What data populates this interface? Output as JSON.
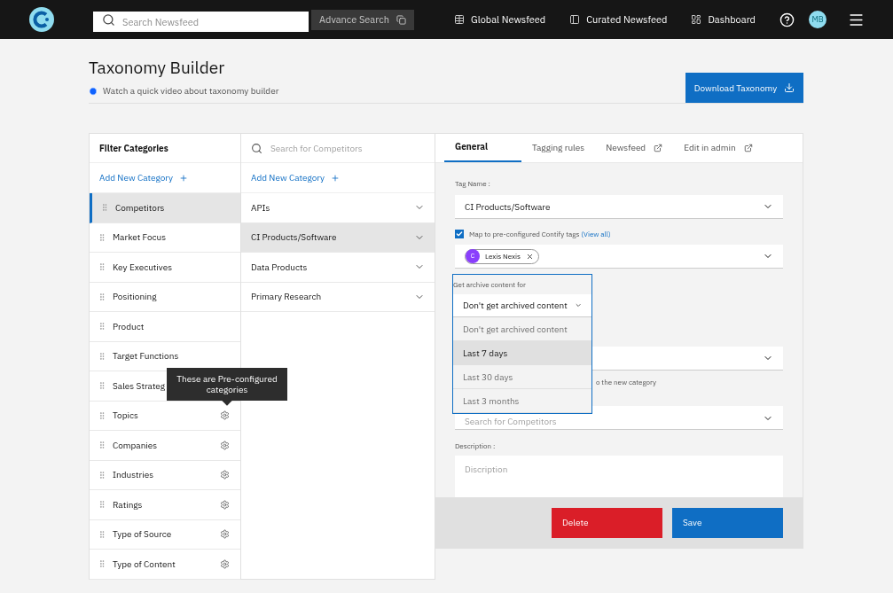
{
  "nav": {
    "search": {
      "placeholder": "Search Newsfeed"
    },
    "advance_search": "Advance Search",
    "links": [
      {
        "label": "Global Newsfeed",
        "kind": "table"
      },
      {
        "label": "Curated Newsfeed",
        "kind": "panel"
      },
      {
        "label": "Dashboard",
        "kind": "dashboard"
      }
    ],
    "avatar": "MB"
  },
  "page": {
    "title": "Taxonomy Builder",
    "video_link": "Watch a quick video about taxonomy builder",
    "download_button": "Download Taxonomy"
  },
  "categories": {
    "title": "Filter Categories",
    "add": "Add New Category",
    "items": [
      {
        "label": "Competitors",
        "selected": true,
        "preconfigured": false
      },
      {
        "label": "Market Focus",
        "selected": false,
        "preconfigured": false
      },
      {
        "label": "Key Executives",
        "selected": false,
        "preconfigured": false
      },
      {
        "label": "Positioning",
        "selected": false,
        "preconfigured": false
      },
      {
        "label": "Product",
        "selected": false,
        "preconfigured": false
      },
      {
        "label": "Target Functions",
        "selected": false,
        "preconfigured": false
      },
      {
        "label": "Sales Strateg",
        "selected": false,
        "preconfigured": false
      },
      {
        "label": "Topics",
        "selected": false,
        "preconfigured": true
      },
      {
        "label": "Companies",
        "selected": false,
        "preconfigured": true
      },
      {
        "label": "Industries",
        "selected": false,
        "preconfigured": true
      },
      {
        "label": "Ratings",
        "selected": false,
        "preconfigured": true
      },
      {
        "label": "Type of Source",
        "selected": false,
        "preconfigured": true
      },
      {
        "label": "Type of Content",
        "selected": false,
        "preconfigured": true
      }
    ],
    "tooltip": "These are Pre-configured categories"
  },
  "subcategories": {
    "search": {
      "placeholder": "Search for Competitors"
    },
    "add": "Add New Category",
    "items": [
      {
        "label": "APIs",
        "selected": false
      },
      {
        "label": "CI Products/Software",
        "selected": true
      },
      {
        "label": "Data Products",
        "selected": false
      },
      {
        "label": "Primary Research",
        "selected": false
      }
    ]
  },
  "editor": {
    "tabs": [
      {
        "label": "General",
        "selected": true,
        "external": false
      },
      {
        "label": "Tagging rules",
        "selected": false,
        "external": false
      },
      {
        "label": "Newsfeed",
        "selected": false,
        "external": true
      },
      {
        "label": "Edit in admin",
        "selected": false,
        "external": true
      }
    ],
    "tag_name": {
      "label": "Tag Name :",
      "value": "CI Products/Software"
    },
    "map_tags": {
      "checked": true,
      "label": "Map to pre-configured Contify tags",
      "link": "(View all)"
    },
    "tags": [
      {
        "initial": "C",
        "label": "Lexis Nexis"
      }
    ],
    "archive": {
      "label": "Get archive content for",
      "value": "Don't get archived content",
      "options": [
        {
          "label": "Don't get archived content",
          "highlighted": false
        },
        {
          "label": "Last 7 days",
          "highlighted": true
        },
        {
          "label": "Last 30 days",
          "highlighted": false
        },
        {
          "label": "Last 3 months",
          "highlighted": false
        }
      ]
    },
    "hidden_help": "o the new category",
    "competitor_field": {
      "placeholder": "Search for Competitors"
    },
    "description": {
      "label": "Description :",
      "placeholder": "Discription"
    },
    "delete_button": "Delete",
    "save_button": "Save"
  }
}
